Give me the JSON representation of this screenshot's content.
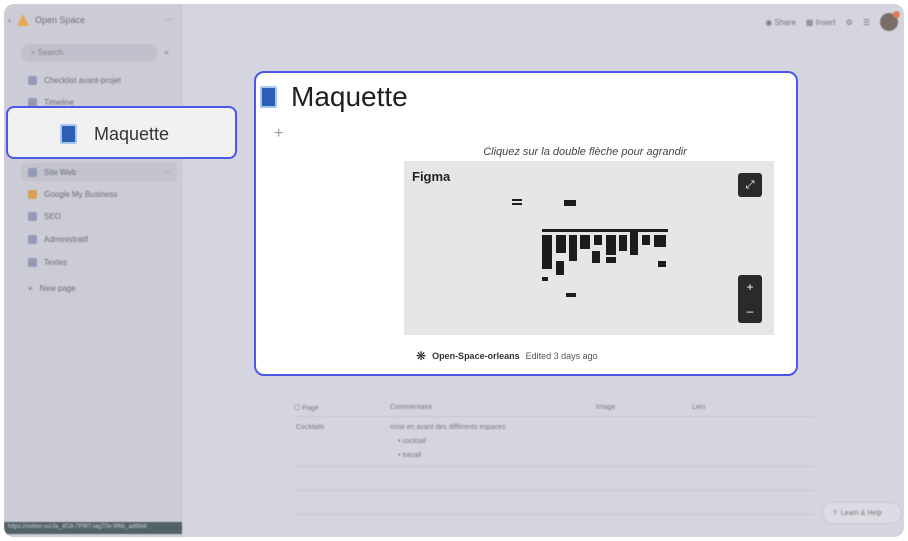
{
  "workspace": {
    "name": "Open Space"
  },
  "sidebar": {
    "search_placeholder": "Search",
    "items": [
      {
        "label": "Checklist avant-projet"
      },
      {
        "label": "Timeline"
      },
      {
        "label": "Site Web"
      },
      {
        "label": "Google My Business"
      },
      {
        "label": "SEO"
      },
      {
        "label": "Administratif"
      },
      {
        "label": "Textes"
      },
      {
        "label": "New page"
      }
    ],
    "url_status": "https://notion.so/Ja_4f18-7P9f7-tag70e-9f6b_ad6fe8"
  },
  "topbar": {
    "share": "Share",
    "insert": "Insert"
  },
  "callout": {
    "label": "Maquette"
  },
  "page": {
    "title": "Maquette",
    "caption": "Cliquez sur la double flèche pour agrandir",
    "embed_label": "Figma",
    "file_name": "Open-Space-orleans",
    "edited": "Edited 3 days ago"
  },
  "table": {
    "headers": [
      "Page",
      "Commentaire",
      "Image",
      "Lien"
    ],
    "row": {
      "page": "Cocktails",
      "comment": "mise en avant des différents espaces",
      "bullets": [
        "cocktail",
        "travail"
      ]
    }
  },
  "help": {
    "label": "Learn & Help"
  }
}
